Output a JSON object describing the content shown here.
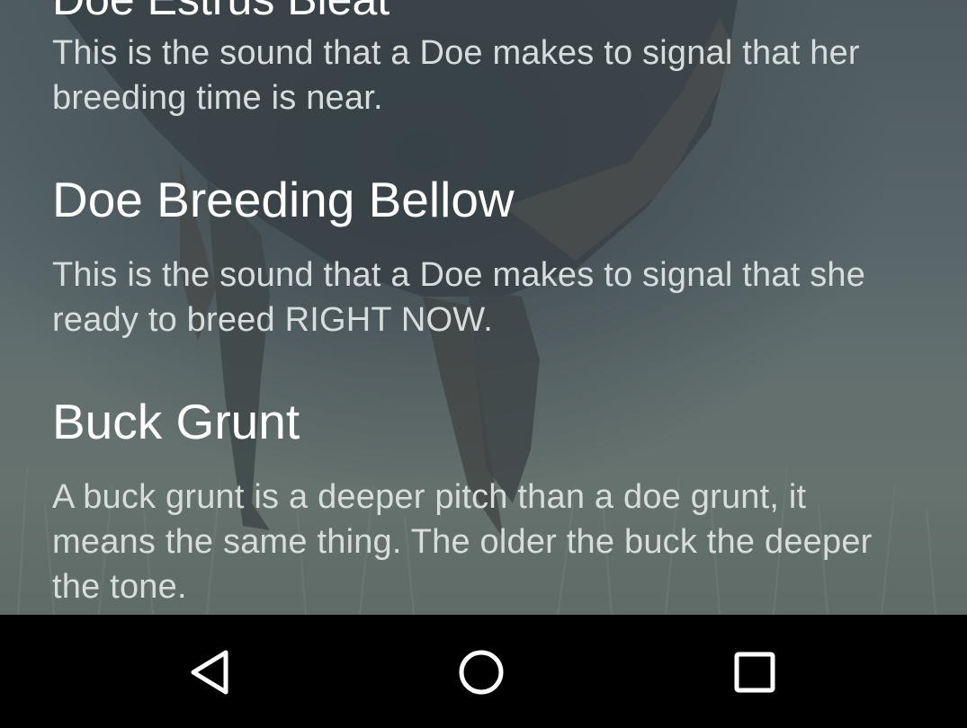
{
  "items": [
    {
      "title": "Doe Estrus Bleat",
      "description": "This is the sound that a Doe makes to signal that her breeding time is near."
    },
    {
      "title": "Doe Breeding Bellow",
      "description": "This is the sound that a Doe makes to signal that she ready to breed RIGHT NOW."
    },
    {
      "title": "Buck Grunt",
      "description": "A buck grunt is a deeper pitch than a doe grunt, it means the same thing. The older the buck the deeper the tone."
    }
  ],
  "navbar": {
    "back_icon": "back-triangle-icon",
    "home_icon": "home-circle-icon",
    "recents_icon": "recents-square-icon"
  },
  "colors": {
    "title_text": "#ffffff",
    "description_text": "#d7dcdd",
    "navbar_bg": "#000000",
    "nav_icon": "#ffffff"
  }
}
